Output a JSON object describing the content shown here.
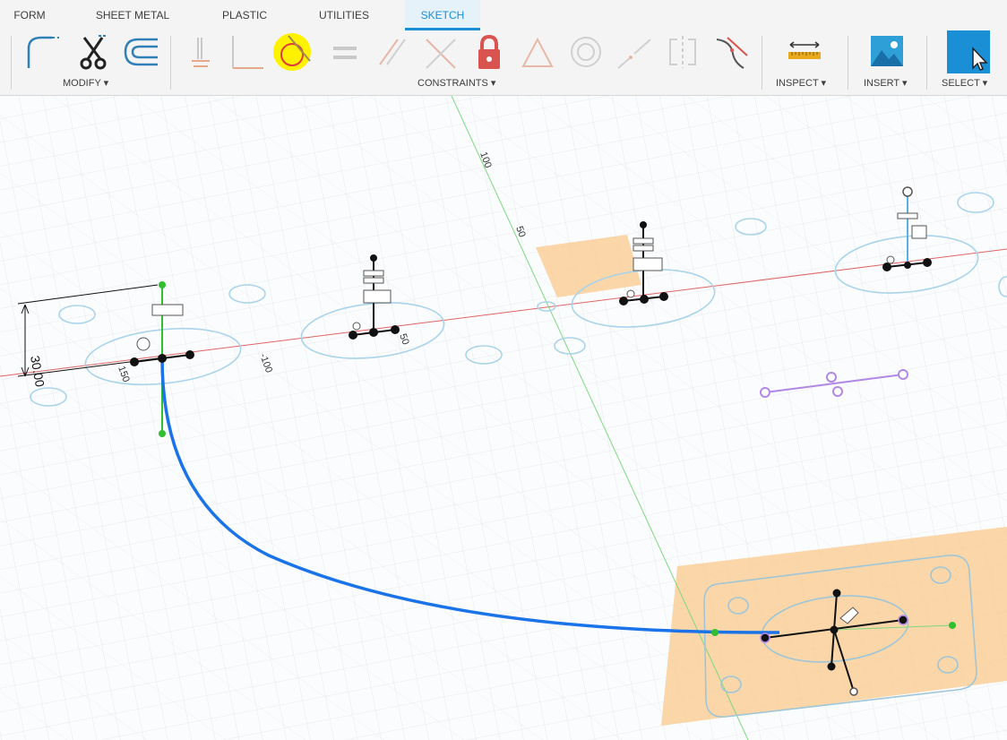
{
  "tabs": [
    "FORM",
    "SHEET METAL",
    "PLASTIC",
    "UTILITIES",
    "SKETCH"
  ],
  "active_tab": "SKETCH",
  "groups": {
    "modify": "MODIFY",
    "constraints": "CONSTRAINTS",
    "inspect": "INSPECT",
    "insert": "INSERT",
    "select": "SELECT"
  },
  "dropdown_arrow": "▾",
  "tools": {
    "modify": [
      "fillet-icon",
      "trim-icon",
      "offset-icon"
    ],
    "constraints": [
      "horizontal-vertical-icon",
      "coincident-icon",
      "tangent-icon",
      "equal-icon",
      "parallel-icon",
      "perpendicular-icon",
      "fix-unfix-icon",
      "midpoint-icon",
      "concentric-icon",
      "collinear-icon",
      "symmetry-icon",
      "curvature-icon"
    ],
    "inspect": [
      "measure-icon"
    ],
    "insert": [
      "insert-image-icon"
    ],
    "select": [
      "select-cursor-icon"
    ]
  },
  "highlighted_tool": "tangent-icon",
  "viewport": {
    "axis_labels": [
      "100",
      "50",
      "-100",
      "50",
      "150"
    ],
    "dimension_value": "30.00"
  },
  "colors": {
    "accent": "#1a8fd6",
    "path_curve": "#1a73e8",
    "sketch_profile": "#a9d4ea",
    "plane_fill": "#f9c98c",
    "x_axis": "#e06464",
    "y_axis": "#7ed87e",
    "construction": "#b088e8",
    "highlight": "#fff200"
  }
}
